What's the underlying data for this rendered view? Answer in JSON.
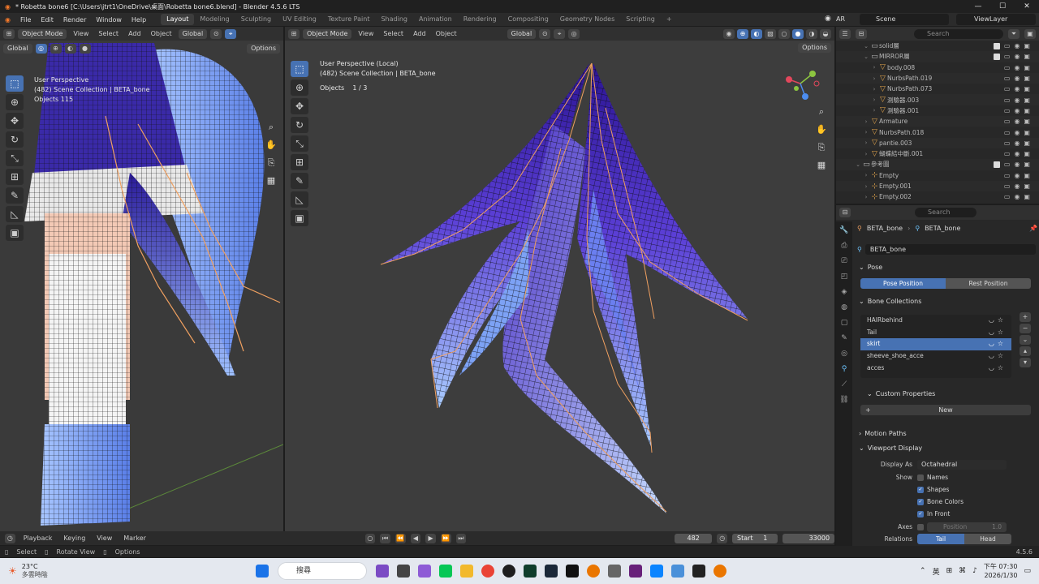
{
  "window": {
    "title": "* Robetta bone6 [C:\\Users\\jtrt1\\OneDrive\\桌面\\Robetta bone6.blend] - Blender 4.5.6 LTS",
    "minimize": "—",
    "maximize": "☐",
    "close": "✕"
  },
  "menubar": {
    "items": [
      "File",
      "Edit",
      "Render",
      "Window",
      "Help"
    ],
    "workspaces": [
      "Layout",
      "Modeling",
      "Sculpting",
      "UV Editing",
      "Texture Paint",
      "Shading",
      "Animation",
      "Rendering",
      "Compositing",
      "Geometry Nodes",
      "Scripting"
    ],
    "active_workspace": "Layout",
    "add_workspace": "+",
    "ar_label": "AR",
    "scene": "Scene",
    "view_layer": "ViewLayer"
  },
  "left_viewport": {
    "mode": "Object Mode",
    "menus": [
      "View",
      "Select",
      "Add",
      "Object"
    ],
    "orientation": "Global",
    "sub_orientation": "Global",
    "options": "Options",
    "info_line1": "User Perspective",
    "info_line2": "(482) Scene Collection | BETA_bone",
    "info_line3": "Objects    115"
  },
  "main_viewport": {
    "mode": "Object Mode",
    "menus": [
      "View",
      "Select",
      "Add",
      "Object"
    ],
    "orientation": "Global",
    "options": "Options",
    "info_line1": "User Perspective (Local)",
    "info_line2": "(482) Scene Collection | BETA_bone",
    "objects_label": "Objects",
    "objects_count": "1 / 3"
  },
  "timeline": {
    "menus": [
      "Playback",
      "Keying",
      "View",
      "Marker"
    ],
    "current_frame": "482",
    "start_label": "Start",
    "start": "1",
    "end": "33000"
  },
  "statusbar": {
    "select": "Select",
    "rotate": "Rotate View",
    "options": "Options",
    "version": "4.5.6"
  },
  "outliner": {
    "search_placeholder": "Search",
    "rows": [
      {
        "name": "solid層",
        "indent": 1,
        "kind": "collection",
        "checked": true
      },
      {
        "name": "MIRROR層",
        "indent": 1,
        "kind": "collection",
        "checked": true
      },
      {
        "name": "body.008",
        "indent": 2,
        "kind": "object",
        "checked": false
      },
      {
        "name": "NurbsPath.019",
        "indent": 2,
        "kind": "object",
        "checked": false
      },
      {
        "name": "NurbsPath.073",
        "indent": 2,
        "kind": "object",
        "checked": false
      },
      {
        "name": "測驗器.003",
        "indent": 2,
        "kind": "object",
        "checked": false
      },
      {
        "name": "測驗器.001",
        "indent": 2,
        "kind": "object",
        "checked": false
      },
      {
        "name": "Armature",
        "indent": 1,
        "kind": "object",
        "checked": false
      },
      {
        "name": "NurbsPath.018",
        "indent": 1,
        "kind": "object",
        "checked": false
      },
      {
        "name": "pantie.003",
        "indent": 1,
        "kind": "object",
        "checked": false
      },
      {
        "name": "蝴蝶結中斷.001",
        "indent": 1,
        "kind": "object",
        "checked": false
      },
      {
        "name": "參考圖",
        "indent": 0,
        "kind": "collection",
        "checked": true
      },
      {
        "name": "Empty",
        "indent": 1,
        "kind": "empty",
        "checked": false
      },
      {
        "name": "Empty.001",
        "indent": 1,
        "kind": "empty",
        "checked": false
      },
      {
        "name": "Empty.002",
        "indent": 1,
        "kind": "empty",
        "checked": false
      }
    ]
  },
  "properties": {
    "search_placeholder": "Search",
    "breadcrumb_object": "BETA_bone",
    "breadcrumb_data": "BETA_bone",
    "data_name": "BETA_bone",
    "pose_panel": "Pose",
    "pose_position": "Pose Position",
    "rest_position": "Rest Position",
    "bone_collections_panel": "Bone Collections",
    "bone_collections": [
      {
        "name": "HAIRbehind",
        "selected": false
      },
      {
        "name": "Tail",
        "selected": false
      },
      {
        "name": "skirt",
        "selected": true
      },
      {
        "name": "sheeve_shoe_acce",
        "selected": false
      },
      {
        "name": "acces",
        "selected": false
      }
    ],
    "custom_properties": "Custom Properties",
    "new_button": "New",
    "motion_paths": "Motion Paths",
    "viewport_display": "Viewport Display",
    "display_as_label": "Display As",
    "display_as": "Octahedral",
    "show_label": "Show",
    "show_names": "Names",
    "show_shapes": "Shapes",
    "show_bone_colors": "Bone Colors",
    "show_in_front": "In Front",
    "axes_label": "Axes",
    "axes_position": "Position",
    "axes_value": "1.0",
    "relations_label": "Relations",
    "relations_tail": "Tail",
    "relations_head": "Head"
  },
  "taskbar": {
    "weather_temp": "23°C",
    "weather_desc": "多雲時陰",
    "search": "搜尋",
    "ime": "英",
    "time": "下午 07:30",
    "date": "2026/1/30"
  },
  "colors": {
    "accent": "#4772b3",
    "mesh_dark": "#3a1fb0",
    "mesh_light": "#8fb6ff",
    "bone": "#f0a060"
  }
}
